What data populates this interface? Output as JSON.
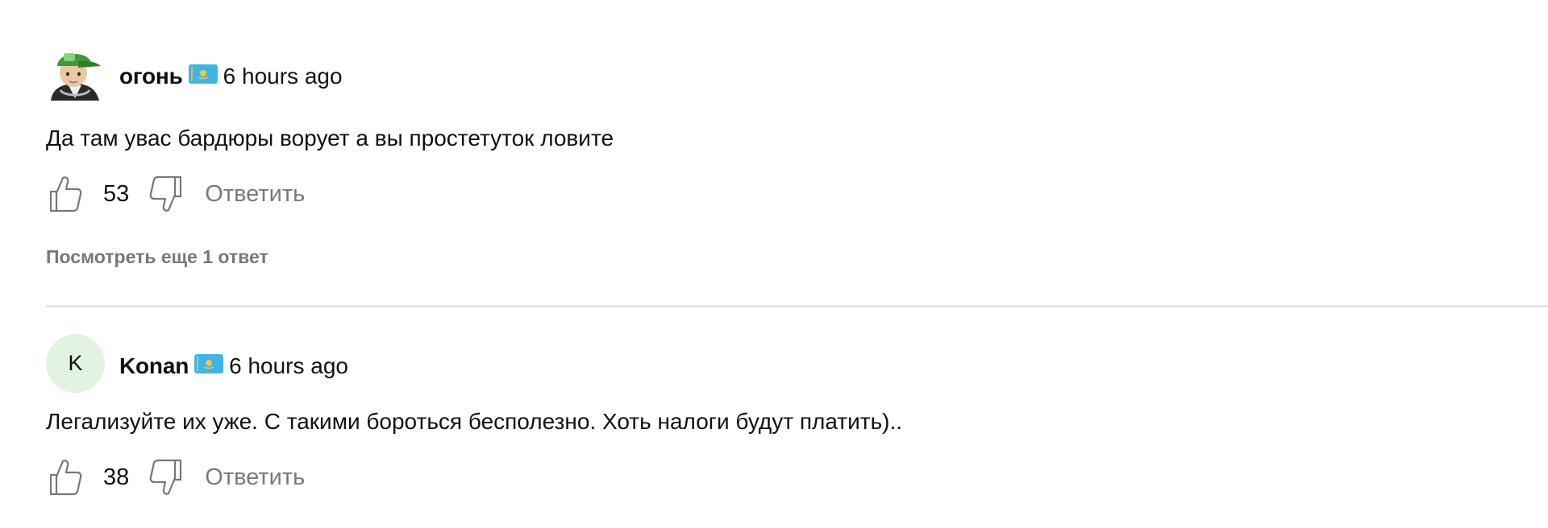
{
  "comments": [
    {
      "username": "огонь",
      "flag_icon": "kazakhstan-flag-icon",
      "time": "6 hours ago",
      "text": "Да там увас бардюры ворует а вы простетуток ловите",
      "likes": "53",
      "reply_label": "Ответить",
      "more_replies_label": "Посмотреть еще 1 ответ",
      "avatar_icon": "cartoon-avatar-icon"
    },
    {
      "username": "Konan",
      "flag_icon": "kazakhstan-flag-icon",
      "time": "6 hours ago",
      "text": "Легализуйте их уже. С такими бороться бесполезно. Хоть налоги будут платить)..",
      "likes": "38",
      "reply_label": "Ответить",
      "avatar_letter": "K"
    }
  ],
  "colors": {
    "flag_blue": "#3fb5e6",
    "flag_yellow": "#f6c343",
    "avatar_letter_bg": "#e3f3e2",
    "muted_text": "#7a7a7a",
    "divider": "#e5e5e5"
  }
}
